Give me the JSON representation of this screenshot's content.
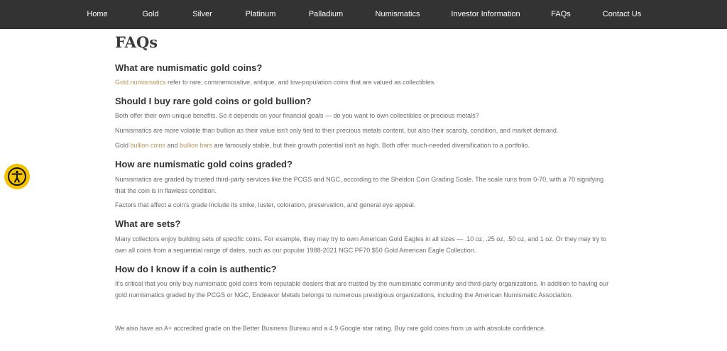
{
  "nav": {
    "items": [
      "Home",
      "Gold",
      "Silver",
      "Platinum",
      "Palladium",
      "Numismatics",
      "Investor Information",
      "FAQs",
      "Contact Us"
    ]
  },
  "page_title": "FAQs",
  "faq": [
    {
      "question": "What are numismatic gold coins?",
      "p1_link": "Gold numismatics",
      "p1_rest": " refer to rare, commemorative, antique, and low-population coins that are valued as collectibles."
    },
    {
      "question": "Should I buy rare gold coins or gold bullion?",
      "p1": "Both offer their own unique benefits. So it depends on your financial goals — do you want to own collectibles or precious metals?",
      "p2": "Numismatics are more volatile than bullion as their value isn't only tied to their precious metals content, but also their scarcity, condition, and market demand.",
      "p3_a": "Gold ",
      "p3_link1": "bullion coins",
      "p3_b": " and ",
      "p3_link2": "bullion bars",
      "p3_c": " are famously stable, but their growth potential isn't as high. Both offer much-needed diversification to a portfolio."
    },
    {
      "question": "How are numismatic gold coins graded?",
      "p1": "Numismatics are graded by trusted third-party services like the PCGS and NGC, according to the Sheldon Coin Grading Scale. The scale runs from 0-70, with a 70 signifying that the coin is in flawless condition.",
      "p2": "Factors that affect a coin's grade include its strike, luster, coloration, preservation, and general eye appeal."
    },
    {
      "question": "What are sets?",
      "p1": "Many collectors enjoy building sets of specific coins. For example, they may try to own American Gold Eagles in all sizes — .10 oz, .25 oz, .50 oz, and 1 oz. Or they may try to own all coins from a sequential range of dates, such as our popular 1988-2021 NGC PF70 $50 Gold American Eagle Collection."
    },
    {
      "question": "How do I know if a coin is authentic?",
      "p1": "It's critical that you only buy numismatic gold coins from reputable dealers that are trusted by the numismatic community and third-party organizations. In addition to having our gold numismatics graded by the PCGS or NGC, Endeavor Metals belongs to numerous prestigious organizations, including the American Numismatic Association.",
      "p2": "We also have an A+ accredited grade on the Better Business Bureau and a 4.9 Google star rating. Buy rare gold coins from us with absolute confidence."
    }
  ],
  "accessibility": {
    "icon": "accessibility-icon"
  },
  "colors": {
    "nav_bg": "#333333",
    "link": "#b5945b",
    "text": "#6b6b6b",
    "heading": "#333333",
    "access_bg": "#f2c200"
  }
}
